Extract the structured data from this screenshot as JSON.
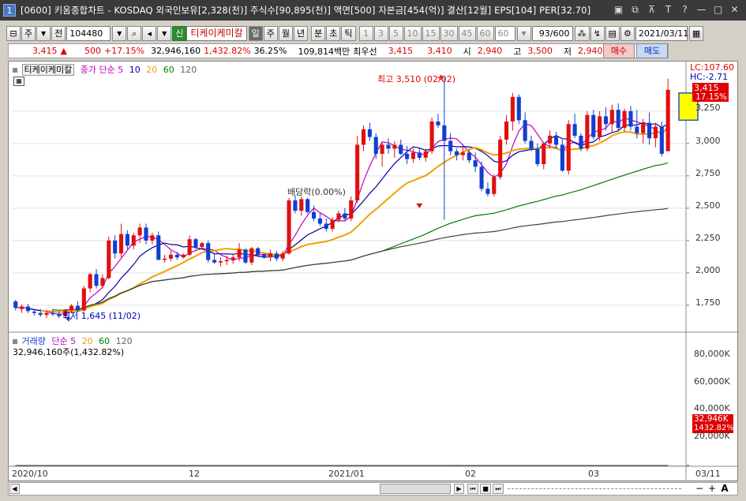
{
  "window": {
    "number": "1",
    "title": "[0600] 키움종합차트 - KOSDAQ 외국인보유[2,328(천)] 주식수[90,895(천)] 액면[500] 자본금[454(억)] 결산[12월] EPS[104] PER[32.70]",
    "controls": [
      "▣",
      "⧉",
      "⊼",
      "T",
      "?",
      "—",
      "□",
      "✕"
    ]
  },
  "toolbar": {
    "period_label": "주",
    "prev_label": "전",
    "code": "104480",
    "stock_name": "티케이케미칼",
    "shin_label": "신",
    "timeframes": [
      "일",
      "주",
      "월",
      "년",
      "분",
      "초",
      "틱"
    ],
    "selected_timeframe": "일",
    "minute_options": [
      "1",
      "3",
      "5",
      "10",
      "15",
      "30",
      "45",
      "60"
    ],
    "minute_value": "60",
    "count": "93/600",
    "date": "2021/03/11"
  },
  "quote": {
    "price": "3,415",
    "change_arrow": "▲",
    "change": "500",
    "change_pct": "+17.15%",
    "volume": "32,946,160",
    "volume_pct": "1,432.82%",
    "turnover_pct": "36.25%",
    "amount": "109,814백만",
    "best_ask_label": "최우선",
    "best_ask": "3,415",
    "best_bid": "3,410",
    "open_label": "시",
    "open": "2,940",
    "high_label": "고",
    "high": "3,500",
    "low_label": "저",
    "low": "2,940",
    "buy_label": "매수",
    "sell_label": "매도"
  },
  "legend": {
    "stock": "티케이케미칼",
    "ma_prefix": "종가 단순",
    "ma_periods": [
      "5",
      "10",
      "20",
      "60",
      "120"
    ],
    "vol_label": "거래량",
    "vol_ma_prefix": "단순",
    "vol_ma_periods": [
      "5",
      "20",
      "60",
      "120"
    ],
    "vol_value": "32,946,160주(1,432.82%)"
  },
  "annotations": {
    "high": "최고 3,510 (02/02)",
    "low": "최저 1,645 (11/02)",
    "dividend": "배당락(0.00%)",
    "lc": "LC:107.60",
    "hc": "HC:-2.71",
    "price_tag": "3,415",
    "pct_tag": "17.15%",
    "vol_tag": "32,946K",
    "vol_pct_tag": "1432.82%"
  },
  "axes": {
    "price_ticks": [
      "3,250",
      "3,000",
      "2,750",
      "2,500",
      "2,250",
      "2,000",
      "1,750"
    ],
    "volume_ticks": [
      "80,000K",
      "60,000K",
      "40,000K",
      "20,000K"
    ],
    "date_ticks": [
      "2020/10",
      "12",
      "2021/01",
      "02",
      "03"
    ],
    "last_date": "03/11"
  },
  "colors": {
    "up": "#e01010",
    "down": "#1040d0",
    "ma5": "#c000c0",
    "ma10": "#0000a0",
    "ma20": "#f0a000",
    "ma60": "#008000",
    "ma120": "#404040"
  },
  "chart_data": {
    "type": "candlestick",
    "price_range": [
      1560,
      3560
    ],
    "volume_range": [
      0,
      92000
    ],
    "dividend_index": 65,
    "high_index": 69,
    "low_index": 8,
    "candles": [
      [
        1780,
        1790,
        1710,
        1730
      ],
      [
        1720,
        1755,
        1690,
        1740
      ],
      [
        1740,
        1760,
        1690,
        1705
      ],
      [
        1700,
        1720,
        1670,
        1690
      ],
      [
        1690,
        1720,
        1660,
        1675
      ],
      [
        1675,
        1710,
        1650,
        1690
      ],
      [
        1690,
        1720,
        1665,
        1680
      ],
      [
        1680,
        1705,
        1650,
        1665
      ],
      [
        1665,
        1720,
        1645,
        1710
      ],
      [
        1710,
        1760,
        1690,
        1745
      ],
      [
        1745,
        1780,
        1700,
        1710
      ],
      [
        1710,
        1900,
        1700,
        1880
      ],
      [
        1880,
        2000,
        1850,
        1990
      ],
      [
        1990,
        2030,
        1880,
        1900
      ],
      [
        1900,
        1990,
        1880,
        1960
      ],
      [
        1960,
        2280,
        1950,
        2250
      ],
      [
        2250,
        2290,
        2110,
        2150
      ],
      [
        2150,
        2380,
        2120,
        2300
      ],
      [
        2300,
        2330,
        2180,
        2210
      ],
      [
        2210,
        2310,
        2180,
        2290
      ],
      [
        2290,
        2380,
        2230,
        2350
      ],
      [
        2350,
        2380,
        2220,
        2250
      ],
      [
        2250,
        2310,
        2220,
        2290
      ],
      [
        2290,
        2320,
        2120,
        2100
      ],
      [
        2100,
        2140,
        2080,
        2110
      ],
      [
        2110,
        2170,
        2090,
        2140
      ],
      [
        2140,
        2160,
        2100,
        2120
      ],
      [
        2120,
        2150,
        2110,
        2140
      ],
      [
        2140,
        2290,
        2130,
        2260
      ],
      [
        2260,
        2270,
        2180,
        2200
      ],
      [
        2200,
        2240,
        2180,
        2230
      ],
      [
        2230,
        2250,
        2080,
        2100
      ],
      [
        2100,
        2150,
        2070,
        2080
      ],
      [
        2080,
        2120,
        2050,
        2090
      ],
      [
        2090,
        2130,
        2060,
        2100
      ],
      [
        2100,
        2150,
        2070,
        2120
      ],
      [
        2120,
        2230,
        2090,
        2180
      ],
      [
        2180,
        2190,
        2070,
        2080
      ],
      [
        2080,
        2200,
        2060,
        2190
      ],
      [
        2190,
        2200,
        2120,
        2140
      ],
      [
        2140,
        2150,
        2110,
        2120
      ],
      [
        2120,
        2180,
        2090,
        2150
      ],
      [
        2150,
        2170,
        2090,
        2110
      ],
      [
        2110,
        2170,
        2090,
        2150
      ],
      [
        2150,
        2580,
        2140,
        2560
      ],
      [
        2560,
        2600,
        2460,
        2480
      ],
      [
        2480,
        2590,
        2440,
        2570
      ],
      [
        2570,
        2580,
        2460,
        2470
      ],
      [
        2470,
        2520,
        2400,
        2420
      ],
      [
        2420,
        2460,
        2360,
        2380
      ],
      [
        2380,
        2420,
        2320,
        2340
      ],
      [
        2340,
        2430,
        2320,
        2410
      ],
      [
        2410,
        2480,
        2390,
        2460
      ],
      [
        2460,
        2500,
        2400,
        2420
      ],
      [
        2420,
        2590,
        2400,
        2560
      ],
      [
        2560,
        3060,
        2540,
        2990
      ],
      [
        2990,
        3140,
        2940,
        3110
      ],
      [
        3110,
        3160,
        3020,
        3050
      ],
      [
        3050,
        3080,
        2880,
        2920
      ],
      [
        2920,
        3010,
        2820,
        2990
      ],
      [
        2990,
        3040,
        2920,
        2960
      ],
      [
        2960,
        3020,
        2890,
        2990
      ],
      [
        2990,
        3030,
        2910,
        2920
      ],
      [
        2920,
        2980,
        2840,
        2880
      ],
      [
        2880,
        2960,
        2850,
        2930
      ],
      [
        2930,
        2960,
        2870,
        2890
      ],
      [
        2890,
        2960,
        2860,
        2940
      ],
      [
        2940,
        3200,
        2920,
        3170
      ],
      [
        3170,
        3230,
        3120,
        3140
      ],
      [
        3140,
        3510,
        2410,
        3020
      ],
      [
        3020,
        3080,
        2910,
        2940
      ],
      [
        2940,
        2960,
        2870,
        2910
      ],
      [
        2910,
        2970,
        2870,
        2930
      ],
      [
        2930,
        2950,
        2850,
        2870
      ],
      [
        2870,
        2930,
        2780,
        2820
      ],
      [
        2820,
        2860,
        2630,
        2650
      ],
      [
        2650,
        2700,
        2590,
        2610
      ],
      [
        2610,
        2760,
        2590,
        2740
      ],
      [
        2740,
        3060,
        2720,
        3030
      ],
      [
        3030,
        3220,
        2990,
        3170
      ],
      [
        3170,
        3390,
        3100,
        3360
      ],
      [
        3360,
        3380,
        3150,
        3180
      ],
      [
        3180,
        3240,
        3000,
        3020
      ],
      [
        3020,
        3060,
        2940,
        2960
      ],
      [
        2960,
        3000,
        2820,
        2840
      ],
      [
        2840,
        3010,
        2800,
        3000
      ],
      [
        3000,
        3100,
        2960,
        3060
      ],
      [
        3060,
        3090,
        2960,
        2990
      ],
      [
        2990,
        3030,
        2780,
        2790
      ],
      [
        2790,
        3180,
        2760,
        3150
      ],
      [
        3150,
        3230,
        3040,
        3060
      ],
      [
        3060,
        3080,
        2940,
        2960
      ],
      [
        2960,
        3250,
        2940,
        3220
      ],
      [
        3220,
        3260,
        3030,
        3050
      ],
      [
        3050,
        3250,
        3020,
        3210
      ],
      [
        3210,
        3280,
        3100,
        3150
      ],
      [
        3150,
        3300,
        3080,
        3260
      ],
      [
        3260,
        3310,
        3100,
        3120
      ],
      [
        3120,
        3270,
        3090,
        3250
      ],
      [
        3250,
        3290,
        3100,
        3130
      ],
      [
        3130,
        3260,
        3040,
        3080
      ],
      [
        3080,
        3190,
        3000,
        3160
      ],
      [
        3160,
        3240,
        2990,
        3040
      ],
      [
        3040,
        3160,
        2970,
        3130
      ],
      [
        3130,
        3170,
        2900,
        2920
      ],
      [
        2940,
        3500,
        2940,
        3415
      ]
    ],
    "volumes": [
      2,
      1,
      1,
      1,
      1,
      1,
      1,
      1,
      2,
      1,
      2,
      15,
      3,
      2,
      4,
      34,
      6,
      25,
      5,
      4,
      6,
      4,
      3,
      8,
      2,
      3,
      2,
      2,
      9,
      3,
      2,
      5,
      2,
      2,
      2,
      3,
      6,
      3,
      10,
      4,
      3,
      3,
      2,
      3,
      88,
      12,
      18,
      10,
      8,
      6,
      5,
      9,
      8,
      6,
      14,
      52,
      19,
      12,
      8,
      7,
      6,
      6,
      6,
      5,
      6,
      4,
      5,
      22,
      9,
      67,
      40,
      14,
      8,
      7,
      6,
      9,
      5,
      6,
      18,
      14,
      12,
      11,
      8,
      7,
      6,
      8,
      10,
      6,
      9,
      13,
      6,
      5,
      12,
      5,
      10,
      6,
      9,
      5,
      7,
      6,
      5,
      4,
      6,
      8,
      6,
      33
    ],
    "ma": [
      {
        "name": "5",
        "color": "#c000c0"
      },
      {
        "name": "10",
        "color": "#0000a0"
      },
      {
        "name": "20",
        "color": "#f0a000"
      },
      {
        "name": "60",
        "color": "#008000"
      },
      {
        "name": "120",
        "color": "#404040"
      }
    ]
  }
}
